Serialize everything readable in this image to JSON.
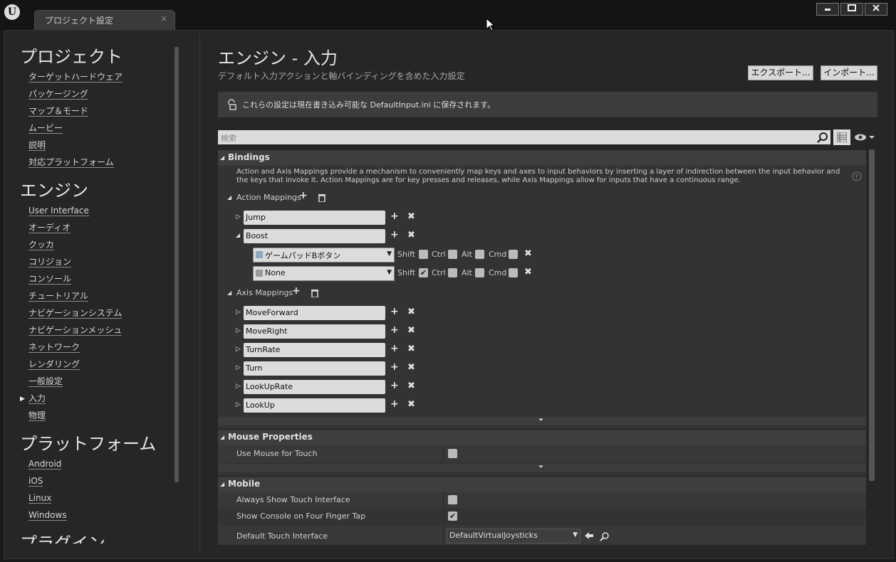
{
  "window": {
    "tab_title": "プロジェクト設定",
    "tab_close": "×",
    "logo": "U",
    "buttons": [
      "minimize-icon",
      "maximize-icon",
      "close-icon"
    ]
  },
  "sidebar": {
    "sections": [
      {
        "title": "プロジェクト",
        "items": [
          "ターゲットハードウェア",
          "パッケージング",
          "マップ＆モード",
          "ムービー",
          "説明",
          "対応プラットフォーム"
        ]
      },
      {
        "title": "エンジン",
        "items": [
          "User Interface",
          "オーディオ",
          "クッカ",
          "コリジョン",
          "コンソール",
          "チュートリアル",
          "ナビゲーションシステム",
          "ナビゲーションメッシュ",
          "ネットワーク",
          "レンダリング",
          "一般設定",
          "入力",
          "物理"
        ]
      },
      {
        "title": "プラットフォーム",
        "items": [
          "Android",
          "iOS",
          "Linux",
          "Windows"
        ]
      },
      {
        "title": "プラグイン",
        "items": []
      }
    ],
    "selected": "入力"
  },
  "header": {
    "title": "エンジン - 入力",
    "subtitle": "デフォルト入力アクションと軸バインディングを含めた入力設定",
    "export_label": "エクスポート...",
    "import_label": "インポート..."
  },
  "notice": {
    "text": "これらの設定は現在書き込み可能な DefaultInput.ini に保存されます。",
    "icon": "unlock-icon"
  },
  "search": {
    "placeholder": "検索"
  },
  "bindings": {
    "title": "Bindings",
    "description": "Action and Axis Mappings provide a mechanism to conveniently map keys and axes to input behaviors by inserting a layer of indirection between the input behavior and the keys that invoke it. Action Mappings are for key presses and releases, while Axis Mappings allow for inputs that have a continuous range.",
    "action_mappings_label": "Action Mappings",
    "axis_mappings_label": "Axis Mappings",
    "actions": [
      {
        "name": "Jump",
        "expanded": false
      },
      {
        "name": "Boost",
        "expanded": true
      }
    ],
    "boost_keys": [
      {
        "key": "ゲームパッドBボタン",
        "shift": false,
        "ctrl": false,
        "alt": false,
        "cmd": false
      },
      {
        "key": "None",
        "shift": true,
        "ctrl": false,
        "alt": false,
        "cmd": false
      }
    ],
    "modifier_labels": {
      "shift": "Shift",
      "ctrl": "Ctrl",
      "alt": "Alt",
      "cmd": "Cmd"
    },
    "axes": [
      "MoveForward",
      "MoveRight",
      "TurnRate",
      "Turn",
      "LookUpRate",
      "LookUp"
    ]
  },
  "mouse_properties": {
    "title": "Mouse Properties",
    "use_mouse_for_touch_label": "Use Mouse for Touch",
    "use_mouse_for_touch": false
  },
  "mobile": {
    "title": "Mobile",
    "always_show_touch_label": "Always Show Touch Interface",
    "always_show_touch": false,
    "show_console_label": "Show Console on Four Finger Tap",
    "show_console": true,
    "default_touch_label": "Default Touch Interface",
    "default_touch_value": "DefaultVirtualJoysticks"
  }
}
